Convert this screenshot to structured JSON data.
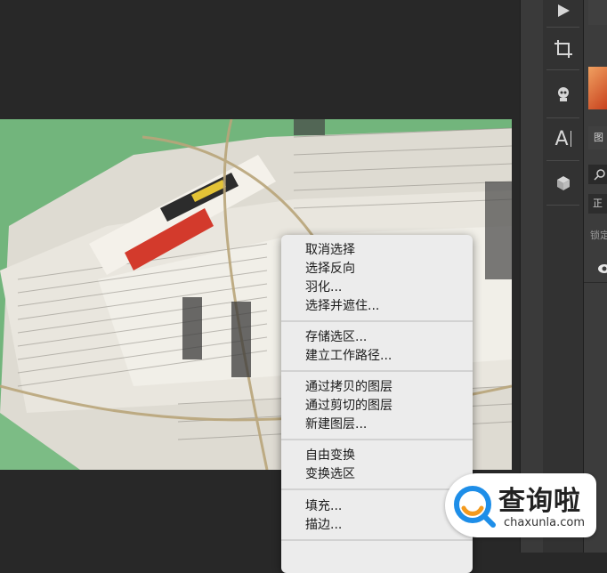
{
  "context_menu": {
    "groups": [
      [
        "取消选择",
        "选择反向",
        "羽化...",
        "选择并遮住..."
      ],
      [
        "存储选区...",
        "建立工作路径..."
      ],
      [
        "通过拷贝的图层",
        "通过剪切的图层",
        "新建图层..."
      ],
      [
        "自由变换",
        "变换选区"
      ],
      [
        "填充...",
        "描边..."
      ]
    ]
  },
  "toolbar": {
    "tools": [
      "play-icon",
      "crop-icon",
      "puppet-warp-icon",
      "character-panel-icon",
      "3d-icon"
    ],
    "character_label": "A"
  },
  "panel": {
    "tab_label": "图",
    "blend_label": "正",
    "lock_label": "锁定"
  },
  "watermark": {
    "title": "查询啦",
    "url": "chaxunla.com"
  },
  "colors": {
    "menu_bg": "#ececec",
    "workspace_bg": "#282828",
    "canvas_green": "#6fb57b",
    "watermark_blue": "#1e8ee8",
    "watermark_orange": "#f39a1e"
  }
}
